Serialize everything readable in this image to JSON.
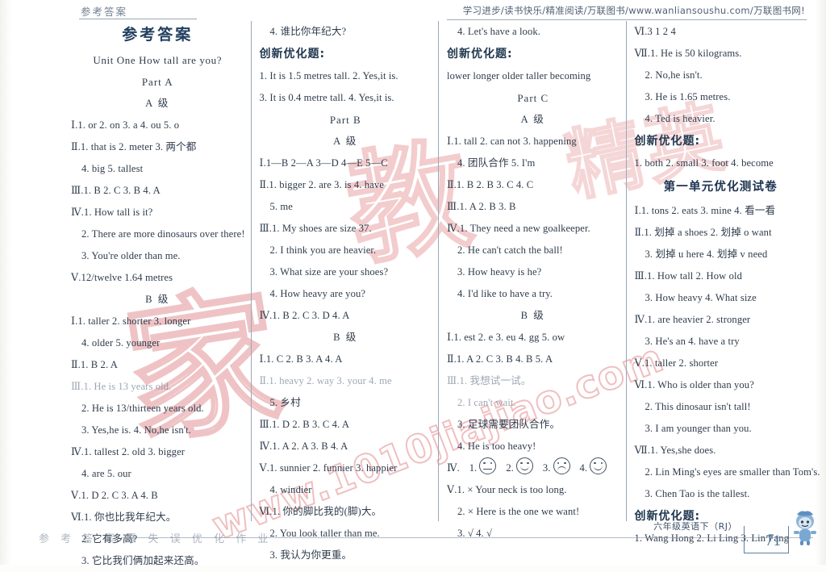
{
  "header": {
    "left_running_head": "参考答案",
    "right_running_head": "学习进步/读书快乐/精准阅读/万联图书/www.wanliansoushu.com/万联图书网!"
  },
  "watermarks": {
    "seal_main": "家",
    "seal_second": "教",
    "url": "www.1010jiajiao.com",
    "small": "精英"
  },
  "footer": {
    "left_text": "参 考 答 案 零 失 误 优 化 作 业",
    "book_title": "六年级英语下（RJ）",
    "page_number": "71"
  },
  "columns": [
    {
      "id": "column-1",
      "blocks": [
        {
          "type": "title",
          "text": "参考答案"
        },
        {
          "type": "unit",
          "text": "Unit One   How tall are you?"
        },
        {
          "type": "sect",
          "text": "Part A"
        },
        {
          "type": "grade",
          "text": "A 级"
        },
        {
          "type": "line",
          "text": "Ⅰ.1. or   2. on   3. a   4. ou   5. o"
        },
        {
          "type": "line",
          "text": "Ⅱ.1. that is    2. meter   3. 两个都"
        },
        {
          "type": "line",
          "indent": 1,
          "text": "4. big   5. tallest"
        },
        {
          "type": "line",
          "text": "Ⅲ.1. B   2. C   3. B   4. A"
        },
        {
          "type": "line",
          "text": "Ⅳ.1. How tall is it?"
        },
        {
          "type": "line",
          "indent": 1,
          "text": "2. There are more dinosaurs over there!"
        },
        {
          "type": "line",
          "indent": 1,
          "text": "3. You're older than me."
        },
        {
          "type": "line",
          "text": "Ⅴ.12/twelve   1.64 metres"
        },
        {
          "type": "grade",
          "text": "B 级"
        },
        {
          "type": "line",
          "text": "Ⅰ.1. taller   2. shorter   3. longer"
        },
        {
          "type": "line",
          "indent": 1,
          "text": "4. older   5. younger"
        },
        {
          "type": "line",
          "text": "Ⅱ.1. B   2. A"
        },
        {
          "type": "line",
          "faded": true,
          "text": "Ⅲ.1. He is 13 years old."
        },
        {
          "type": "line",
          "indent": 1,
          "text": "2. He is 13/thirteen years old."
        },
        {
          "type": "line",
          "indent": 1,
          "text": "3. Yes,he is.   4. No,he isn't."
        },
        {
          "type": "line",
          "text": "Ⅳ.1. tallest   2. old   3. bigger"
        },
        {
          "type": "line",
          "indent": 1,
          "text": "4. are   5. our"
        },
        {
          "type": "line",
          "text": "Ⅴ.1. D   2. C   3. A   4. B"
        },
        {
          "type": "line",
          "text": "Ⅵ.1. 你也比我年纪大。"
        },
        {
          "type": "line",
          "indent": 1,
          "text": "2. 它有多高?"
        },
        {
          "type": "line",
          "indent": 1,
          "text": "3. 它比我们俩加起来还高。"
        }
      ]
    },
    {
      "id": "column-2",
      "blocks": [
        {
          "type": "line",
          "indent": 1,
          "text": "4. 谁比你年纪大?"
        },
        {
          "type": "chead",
          "text": "创新优化题:"
        },
        {
          "type": "line",
          "text": "1. It is 1.5 metres tall.    2. Yes,it is."
        },
        {
          "type": "line",
          "text": "3. It is 0.4 metre tall.    4. Yes,it is."
        },
        {
          "type": "sect",
          "text": "Part B"
        },
        {
          "type": "grade",
          "text": "A 级"
        },
        {
          "type": "line",
          "text": "Ⅰ.1—B   2—A   3—D   4—E   5—C"
        },
        {
          "type": "line",
          "text": "Ⅱ.1. bigger   2. are   3. is   4. have"
        },
        {
          "type": "line",
          "indent": 1,
          "text": "5. me"
        },
        {
          "type": "line",
          "text": "Ⅲ.1. My shoes are size 37."
        },
        {
          "type": "line",
          "indent": 1,
          "text": "2. I think you are heavier."
        },
        {
          "type": "line",
          "indent": 1,
          "text": "3. What size are your shoes?"
        },
        {
          "type": "line",
          "indent": 1,
          "text": "4. How heavy are you?"
        },
        {
          "type": "line",
          "text": "Ⅳ.1. B   2. C   3. D   4. A"
        },
        {
          "type": "grade",
          "text": "B 级"
        },
        {
          "type": "line",
          "text": "Ⅰ.1. C   2. B   3. A   4. A"
        },
        {
          "type": "line",
          "faded": true,
          "text": "Ⅱ.1. heavy   2. way   3. your   4. me"
        },
        {
          "type": "line",
          "indent": 1,
          "text": "5. 乡村"
        },
        {
          "type": "line",
          "text": "Ⅲ.1. D   2. B   3. C   4. A"
        },
        {
          "type": "line",
          "text": "Ⅳ.1. A   2. A   3. B   4. A"
        },
        {
          "type": "line",
          "text": "Ⅴ.1. sunnier   2. funnier   3. happier"
        },
        {
          "type": "line",
          "indent": 1,
          "text": "4. windier"
        },
        {
          "type": "line",
          "text": "Ⅵ.1. 你的脚比我的(脚)大。"
        },
        {
          "type": "line",
          "indent": 1,
          "text": "2. You look taller than me."
        },
        {
          "type": "line",
          "indent": 1,
          "text": "3. 我认为你更重。"
        }
      ]
    },
    {
      "id": "column-3",
      "blocks": [
        {
          "type": "line",
          "indent": 1,
          "text": "4. Let's have a look."
        },
        {
          "type": "chead",
          "text": "创新优化题:"
        },
        {
          "type": "line",
          "text": "lower   longer   older   taller   becoming"
        },
        {
          "type": "sect",
          "text": "Part C"
        },
        {
          "type": "grade",
          "text": "A 级"
        },
        {
          "type": "line",
          "text": "Ⅰ.1. tall   2. can not   3. happening"
        },
        {
          "type": "line",
          "indent": 1,
          "text": "4. 团队合作   5. I'm"
        },
        {
          "type": "line",
          "text": "Ⅱ.1. B   2. B   3. C   4. C"
        },
        {
          "type": "line",
          "text": "Ⅲ.1. A   2. B   3. B"
        },
        {
          "type": "line",
          "text": "Ⅳ.1. They need a new goalkeeper."
        },
        {
          "type": "line",
          "indent": 1,
          "text": "2. He can't catch the ball!"
        },
        {
          "type": "line",
          "indent": 1,
          "text": "3. How heavy is he?"
        },
        {
          "type": "line",
          "indent": 1,
          "text": "4. I'd like to have a try."
        },
        {
          "type": "grade",
          "text": "B 级"
        },
        {
          "type": "line",
          "text": "Ⅰ.1. est   2. e   3. eu   4. gg   5. ow"
        },
        {
          "type": "line",
          "text": "Ⅱ.1. A   2. C   3. B   4. B   5. A"
        },
        {
          "type": "line",
          "faded": true,
          "text": "Ⅲ.1. 我想试一试。"
        },
        {
          "type": "line",
          "indent": 1,
          "faded": true,
          "text": "2. I can't wait."
        },
        {
          "type": "line",
          "indent": 1,
          "text": "3. 足球需要团队合作。"
        },
        {
          "type": "line",
          "indent": 1,
          "text": "4. He is too heavy!"
        },
        {
          "type": "smileys",
          "label": "Ⅳ",
          "items": [
            {
              "n": "1.",
              "face": "flat"
            },
            {
              "n": "2.",
              "face": "happy"
            },
            {
              "n": "3.",
              "face": "sad"
            },
            {
              "n": "4.",
              "face": "happy"
            }
          ]
        },
        {
          "type": "line",
          "text": "Ⅴ.1. ×    Your neck is too long."
        },
        {
          "type": "line",
          "indent": 1,
          "text": "2. ×    Here is the one we want!"
        },
        {
          "type": "line",
          "indent": 1,
          "text": "3. √   4. √"
        }
      ]
    },
    {
      "id": "column-4",
      "blocks": [
        {
          "type": "line",
          "text": "Ⅵ.3   1   2   4"
        },
        {
          "type": "line",
          "text": "Ⅶ.1. He is 50 kilograms."
        },
        {
          "type": "line",
          "indent": 1,
          "text": "2. No,he isn't."
        },
        {
          "type": "line",
          "indent": 1,
          "text": "3. He is 1.65 metres."
        },
        {
          "type": "line",
          "indent": 1,
          "text": "4. Ted is heavier."
        },
        {
          "type": "chead",
          "text": "创新优化题:"
        },
        {
          "type": "line",
          "text": "1. both   2. small   3. foot   4. become"
        },
        {
          "type": "testpaper",
          "text": "第一单元优化测试卷"
        },
        {
          "type": "line",
          "text": "Ⅰ.1. tons   2. eats   3. mine   4. 看一看"
        },
        {
          "type": "line",
          "text": "Ⅱ.1. 划掉 a   shoes   2. 划掉 o   want"
        },
        {
          "type": "line",
          "indent": 1,
          "text": "3. 划掉 u   here   4. 划掉 v   need"
        },
        {
          "type": "line",
          "text": "Ⅲ.1. How tall   2. How old"
        },
        {
          "type": "line",
          "indent": 1,
          "text": "3. How heavy   4. What size"
        },
        {
          "type": "line",
          "text": "Ⅳ.1. are heavier   2. stronger"
        },
        {
          "type": "line",
          "indent": 1,
          "text": "3. He's an   4. have a try"
        },
        {
          "type": "line",
          "text": "Ⅴ.1. taller   2. shorter"
        },
        {
          "type": "line",
          "text": "Ⅵ.1. Who is older than you?"
        },
        {
          "type": "line",
          "indent": 1,
          "text": "2. This dinosaur isn't tall!"
        },
        {
          "type": "line",
          "indent": 1,
          "text": "3. I am younger than you."
        },
        {
          "type": "line",
          "text": "Ⅶ.1. Yes,she does."
        },
        {
          "type": "line",
          "indent": 1,
          "text": "2. Lin Ming's eyes are smaller than Tom's."
        },
        {
          "type": "line",
          "indent": 1,
          "text": "3. Chen Tao is the tallest."
        },
        {
          "type": "chead",
          "text": "创新优化题:"
        },
        {
          "type": "line",
          "text": "1. Wang Hong   2. Li Ling   3. Lin Fang"
        }
      ]
    }
  ]
}
